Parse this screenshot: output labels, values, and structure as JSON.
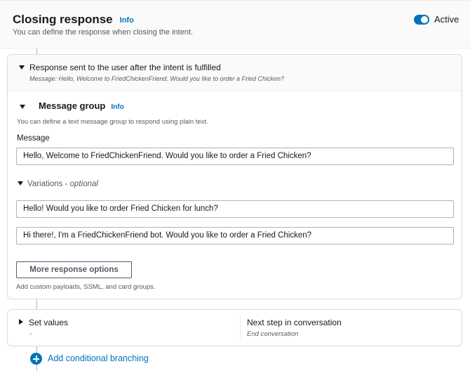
{
  "header": {
    "title": "Closing response",
    "info": "Info",
    "description": "You can define the response when closing the intent.",
    "toggle_label": "Active",
    "toggle_on": true,
    "accent_color": "#0073bb"
  },
  "response_section": {
    "title": "Response sent to the user after the intent is fulfilled",
    "subtitle": "Message: Hello, Welcome to FriedChickenFriend. Would you like to order a Fried Chicken?",
    "message_group": {
      "title": "Message group",
      "info": "Info",
      "description": "You can define a text message group to respond using plain text.",
      "message_label": "Message",
      "message_value": "Hello, Welcome to FriedChickenFriend. Would you like to order a Fried Chicken?",
      "variations_label": "Variations",
      "variations_optional": "optional",
      "variations": [
        "Hello! Would you like to order Fried Chicken for lunch?",
        "Hi there!, I'm a FriedChickenFriend bot. Would you like to order a Fried Chicken?"
      ]
    },
    "more_options_button": "More response options",
    "more_options_description": "Add custom payloads, SSML, and card groups."
  },
  "set_values": {
    "label": "Set values",
    "value": "-",
    "next_step_label": "Next step in conversation",
    "next_step_value": "End conversation"
  },
  "add_branching": {
    "label": "Add conditional branching",
    "icon": "plus-circle-icon"
  }
}
